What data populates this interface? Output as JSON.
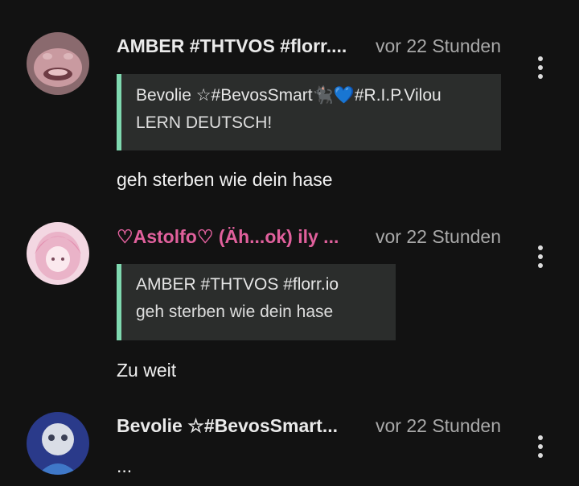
{
  "comments": [
    {
      "author": "AMBER #THTVOS #florr....",
      "time": "vor 22 Stunden",
      "quote": {
        "author": "Bevolie ☆#BevosSmart🐈‍⬛💙#R.I.P.Vilou",
        "text": "LERN DEUTSCH!"
      },
      "text": "geh sterben wie dein hase"
    },
    {
      "author": "♡Astolfo♡ (Äh...ok) ily ...",
      "time": "vor 22 Stunden",
      "quote": {
        "author": "AMBER #THTVOS #florr.io",
        "text": "geh sterben wie dein hase"
      },
      "text": "Zu weit"
    },
    {
      "author": "Bevolie ☆#BevosSmart...",
      "time": "vor 22 Stunden",
      "text": "..."
    }
  ],
  "colors": {
    "quote_accent": "#7fd9b0",
    "pink_name": "#e0609c",
    "background": "#121212"
  },
  "icons": {
    "more": "more-vertical-icon"
  }
}
